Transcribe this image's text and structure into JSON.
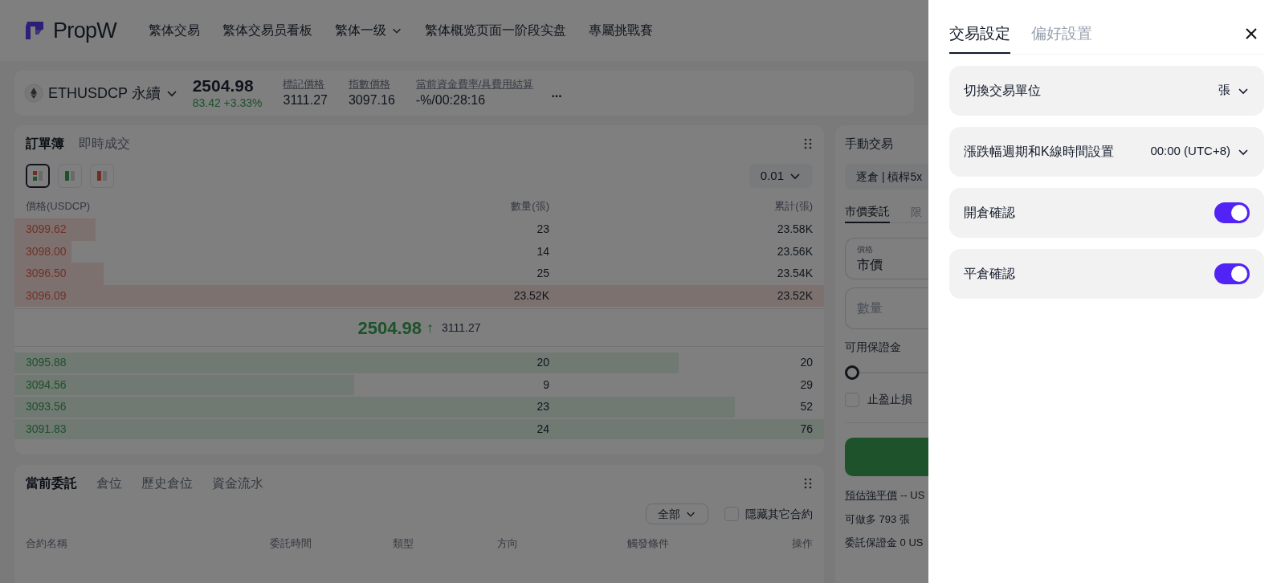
{
  "header": {
    "logo_text": "PropW",
    "nav": [
      {
        "label": "繁体交易",
        "dropdown": false
      },
      {
        "label": "繁体交易员看板",
        "dropdown": false
      },
      {
        "label": "繁体一级",
        "dropdown": true
      },
      {
        "label": "繁体概览页面一阶段实盘",
        "dropdown": false
      },
      {
        "label": "專屬挑戰賽",
        "dropdown": false
      }
    ]
  },
  "ticker": {
    "symbol": "ETHUSDCP 永續",
    "price": "2504.98",
    "change": "83.42 +3.33%",
    "stats": [
      {
        "label": "標記價格",
        "value": "3111.27"
      },
      {
        "label": "指數價格",
        "value": "3097.16"
      },
      {
        "label": "當前資金費率/具費用結算",
        "value": "-%/00:28:16"
      }
    ],
    "more": "..."
  },
  "order_book": {
    "tabs": [
      {
        "label": "訂單簿",
        "selected": true
      },
      {
        "label": "即時成交",
        "selected": false
      }
    ],
    "view_modes": [
      {
        "kind": "both",
        "selected": true
      },
      {
        "kind": "bids",
        "selected": false
      },
      {
        "kind": "asks",
        "selected": false
      }
    ],
    "precision": "0.01",
    "columns": [
      "價格(USDCP)",
      "數量(張)",
      "累計(張)"
    ],
    "asks": [
      {
        "price": "3099.62",
        "amount": "23",
        "total": "23.58K",
        "level": 0.1
      },
      {
        "price": "3098.00",
        "amount": "14",
        "total": "23.56K",
        "level": 0.07
      },
      {
        "price": "3096.50",
        "amount": "25",
        "total": "23.54K",
        "level": 0.11
      },
      {
        "price": "3096.09",
        "amount": "23.52K",
        "total": "23.52K",
        "level": 1
      }
    ],
    "mid": {
      "price": "2504.98",
      "arrow": "↑",
      "mark": "3111.27"
    },
    "bids": [
      {
        "price": "3095.88",
        "amount": "20",
        "total": "20",
        "level": 0.82
      },
      {
        "price": "3094.56",
        "amount": "9",
        "total": "29",
        "level": 0.42
      },
      {
        "price": "3093.56",
        "amount": "23",
        "total": "52",
        "level": 0.89
      },
      {
        "price": "3091.83",
        "amount": "24",
        "total": "76",
        "level": 1
      }
    ]
  },
  "orders_panel": {
    "tabs": [
      {
        "label": "當前委託",
        "selected": true
      },
      {
        "label": "倉位",
        "selected": false
      },
      {
        "label": "歷史倉位",
        "selected": false
      },
      {
        "label": "資金流水",
        "selected": false
      }
    ],
    "filter": "全部",
    "hide_others": {
      "label": "隱藏其它合約",
      "checked": false
    },
    "columns": [
      "合約名稱",
      "委託時間",
      "類型",
      "方向",
      "觸發條件",
      "操作"
    ]
  },
  "trade_panel": {
    "title": "手動交易",
    "margin_mode": "逐倉 | 槓桿5x",
    "tabs": [
      {
        "label": "市價委託",
        "selected": true
      },
      {
        "label": "限",
        "selected": false
      }
    ],
    "price_field": {
      "label": "價格",
      "value": "市價"
    },
    "amount_field": {
      "placeholder": "數量"
    },
    "available_label": "可用保證金",
    "slider": {
      "level": 0
    },
    "tpsl": {
      "label": "止盈止損",
      "checked": false
    },
    "liq_label": "預估強平價",
    "liq_value": "-- US",
    "max_long": "可做多 793 張",
    "order_margin": "委託保證金 0 US"
  },
  "drawer": {
    "tabs": [
      {
        "label": "交易設定",
        "selected": true
      },
      {
        "label": "偏好設置",
        "selected": false
      }
    ],
    "settings": [
      {
        "kind": "select",
        "label": "切換交易單位",
        "value": "張"
      },
      {
        "kind": "select",
        "label": "漲跌幅週期和K線時間設置",
        "value": "00:00 (UTC+8)"
      },
      {
        "kind": "toggle",
        "label": "開倉確認",
        "on": true
      },
      {
        "kind": "toggle",
        "label": "平倉確認",
        "on": true
      }
    ]
  }
}
